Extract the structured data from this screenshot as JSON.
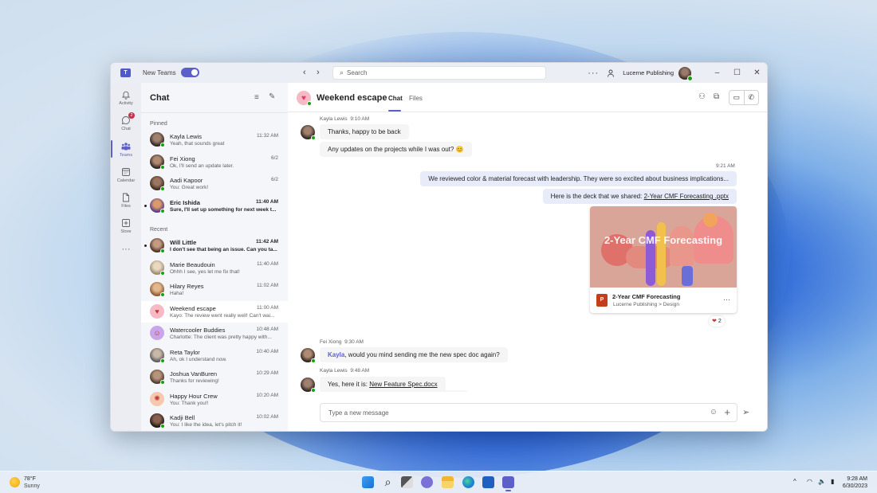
{
  "window": {
    "new_teams_label": "New Teams",
    "new_teams_enabled": true,
    "search_placeholder": "Search",
    "org_name": "Lucerne Publishing",
    "more_label": "···",
    "minimize": "–",
    "maximize": "☐",
    "close": "✕"
  },
  "rail": {
    "items": [
      {
        "label": "Activity",
        "icon": "bell-icon"
      },
      {
        "label": "Chat",
        "icon": "chat-icon",
        "badge": "2"
      },
      {
        "label": "Teams",
        "icon": "teams-icon",
        "active": true
      },
      {
        "label": "Calendar",
        "icon": "calendar-icon"
      },
      {
        "label": "Files",
        "icon": "file-icon"
      },
      {
        "label": "Store",
        "icon": "store-icon"
      }
    ],
    "more": "···"
  },
  "chatlist": {
    "title": "Chat",
    "pinned_label": "Pinned",
    "recent_label": "Recent",
    "pinned": [
      {
        "name": "Kayla Lewis",
        "time": "11:32 AM",
        "preview": "Yeah, that sounds great",
        "unread": false
      },
      {
        "name": "Fei Xiong",
        "time": "6/2",
        "preview": "Ok, I'll send an update later.",
        "unread": false
      },
      {
        "name": "Aadi Kapoor",
        "time": "6/2",
        "preview": "You: Great work!",
        "unread": false
      },
      {
        "name": "Eric Ishida",
        "time": "11:40 AM",
        "preview": "Sure, I'll set up something for next week t...",
        "unread": true
      }
    ],
    "recent": [
      {
        "name": "Will Little",
        "time": "11:42 AM",
        "preview": "I don't see that being an issue. Can you ta...",
        "unread": true
      },
      {
        "name": "Marie Beaudouin",
        "time": "11:40 AM",
        "preview": "Ohhh I see, yes let me fix that!",
        "unread": false
      },
      {
        "name": "Hilary Reyes",
        "time": "11:02 AM",
        "preview": "Haha!",
        "unread": false
      },
      {
        "name": "Weekend escape",
        "time": "11:00 AM",
        "preview": "Kayo: The review went really well! Can't wai...",
        "unread": false,
        "selected": true
      },
      {
        "name": "Watercooler Buddies",
        "time": "10:48 AM",
        "preview": "Charlotte: The client was pretty happy with...",
        "unread": false
      },
      {
        "name": "Reta Taylor",
        "time": "10:40 AM",
        "preview": "Ah, ok I understand now.",
        "unread": false
      },
      {
        "name": "Joshua VanBuren",
        "time": "10:29 AM",
        "preview": "Thanks for reviewing!",
        "unread": false
      },
      {
        "name": "Happy Hour Crew",
        "time": "10:20 AM",
        "preview": "You: Thank you!!",
        "unread": false
      },
      {
        "name": "Kadji Bell",
        "time": "10:02 AM",
        "preview": "You: I like the idea, let's pitch it!",
        "unread": false
      }
    ]
  },
  "conversation": {
    "title": "Weekend escape",
    "tabs": [
      "Chat",
      "Files"
    ],
    "active_tab": "Chat",
    "messages": {
      "m1_sender": "Kayla Lewis",
      "m1_time": "9:10 AM",
      "m1_text1": "Thanks, happy to be back",
      "m1_text2": "Any updates on the projects while I was out? 😊",
      "m2_time": "9:21 AM",
      "m2_text1": "We reviewed color & material forecast with leadership. They were so excited about business implications...",
      "m2_text2_prefix": "Here is the deck that we shared: ",
      "m2_link": "2-Year CMF Forecasting .pptx",
      "card_thumb_title": "2-Year CMF Forecasting",
      "card_name": "2-Year CMF Forecasting",
      "card_path": "Lucerne Publishing > Design",
      "card_app_letter": "P",
      "reaction_emoji": "❤",
      "reaction_count": "2",
      "m3_sender": "Fei Xiong",
      "m3_time": "9:30 AM",
      "m3_mention": "Kayla",
      "m3_text": ", would you mind sending me the new spec doc again?",
      "m4_sender": "Kayla Lewis",
      "m4_time": "9:48 AM",
      "m4_prefix": "Yes, here it is: ",
      "m4_link": "New Feature Spec.docx"
    },
    "composer_placeholder": "Type a new message"
  },
  "taskbar": {
    "weather_temp": "78°F",
    "weather_desc": "Sunny",
    "time": "9:28 AM",
    "date": "6/30/2023",
    "apps": [
      "start",
      "search",
      "task-view",
      "teams-chat",
      "file-explorer",
      "edge",
      "store",
      "teams"
    ]
  }
}
